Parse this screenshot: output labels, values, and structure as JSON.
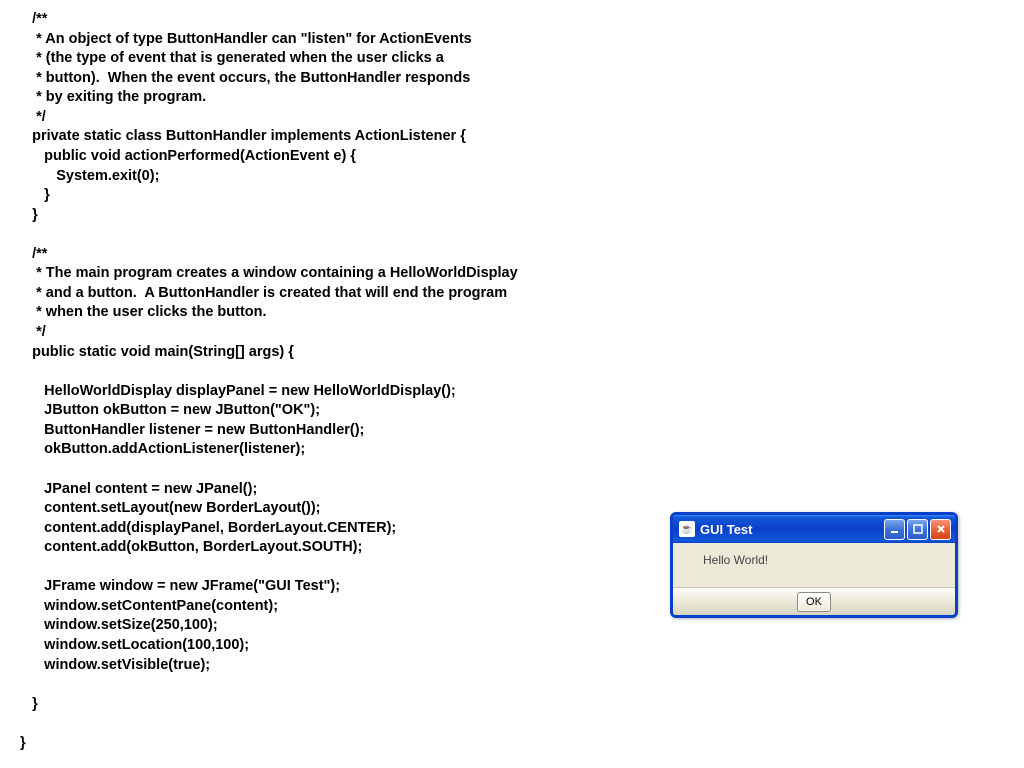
{
  "code": {
    "lines": [
      "   /**",
      "    * An object of type ButtonHandler can \"listen\" for ActionEvents",
      "    * (the type of event that is generated when the user clicks a",
      "    * button).  When the event occurs, the ButtonHandler responds",
      "    * by exiting the program.",
      "    */",
      "   private static class ButtonHandler implements ActionListener {",
      "      public void actionPerformed(ActionEvent e) {",
      "         System.exit(0);",
      "      }",
      "   }",
      "   ",
      "   /**",
      "    * The main program creates a window containing a HelloWorldDisplay",
      "    * and a button.  A ButtonHandler is created that will end the program",
      "    * when the user clicks the button.",
      "    */",
      "   public static void main(String[] args) {",
      "      ",
      "      HelloWorldDisplay displayPanel = new HelloWorldDisplay();",
      "      JButton okButton = new JButton(\"OK\");",
      "      ButtonHandler listener = new ButtonHandler();",
      "      okButton.addActionListener(listener);",
      "",
      "      JPanel content = new JPanel();",
      "      content.setLayout(new BorderLayout());",
      "      content.add(displayPanel, BorderLayout.CENTER);",
      "      content.add(okButton, BorderLayout.SOUTH);",
      "",
      "      JFrame window = new JFrame(\"GUI Test\");",
      "      window.setContentPane(content);",
      "      window.setSize(250,100);",
      "      window.setLocation(100,100);",
      "      window.setVisible(true);",
      "",
      "   }",
      "",
      "}"
    ]
  },
  "gui": {
    "title": "GUI Test",
    "message": "Hello World!",
    "ok_label": "OK",
    "java_icon_label": "☕"
  }
}
